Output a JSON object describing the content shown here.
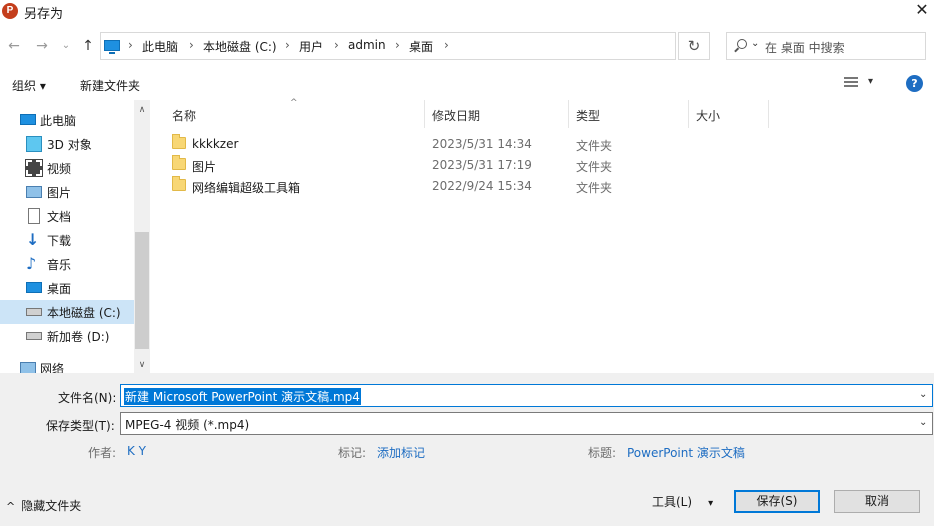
{
  "window": {
    "title": "另存为",
    "app_badge": "P",
    "close_glyph": "✕"
  },
  "nav_buttons": {
    "back": "←",
    "forward": "→",
    "recent": "⌄",
    "up": "↑"
  },
  "address": {
    "crumbs": [
      "此电脑",
      "本地磁盘 (C:)",
      "用户",
      "admin",
      "桌面"
    ],
    "separator": "›",
    "dropdown_glyph": "⌄",
    "refresh_glyph": "↻"
  },
  "search": {
    "placeholder": "在 桌面 中搜索"
  },
  "toolbar": {
    "organize": "组织 ▾",
    "new_folder": "新建文件夹",
    "view_dropdown": "▾",
    "help": "?"
  },
  "nav_pane": {
    "items": [
      {
        "label": "此电脑",
        "icon": "computer-icon",
        "selected": false
      },
      {
        "label": "3D 对象",
        "icon": "cube-icon",
        "selected": false
      },
      {
        "label": "视频",
        "icon": "video-icon",
        "selected": false
      },
      {
        "label": "图片",
        "icon": "picture-icon",
        "selected": false
      },
      {
        "label": "文档",
        "icon": "document-icon",
        "selected": false
      },
      {
        "label": "下载",
        "icon": "download-icon",
        "selected": false
      },
      {
        "label": "音乐",
        "icon": "music-icon",
        "selected": false
      },
      {
        "label": "桌面",
        "icon": "desktop-icon",
        "selected": false
      },
      {
        "label": "本地磁盘 (C:)",
        "icon": "drive-icon",
        "selected": true
      },
      {
        "label": "新加卷 (D:)",
        "icon": "drive-icon",
        "selected": false
      },
      {
        "label": "网络",
        "icon": "network-icon",
        "selected": false
      }
    ],
    "scroll_up": "∧",
    "scroll_down": "∨"
  },
  "file_list": {
    "columns": [
      "名称",
      "修改日期",
      "类型",
      "大小"
    ],
    "sort_indicator": "^",
    "rows": [
      {
        "name": "kkkkzer",
        "modified": "2023/5/31 14:34",
        "type": "文件夹",
        "size": ""
      },
      {
        "name": "图片",
        "modified": "2023/5/31 17:19",
        "type": "文件夹",
        "size": ""
      },
      {
        "name": "网络编辑超级工具箱",
        "modified": "2022/9/24 15:34",
        "type": "文件夹",
        "size": ""
      }
    ]
  },
  "form": {
    "filename_label": "文件名(N):",
    "filename_value": "新建 Microsoft PowerPoint 演示文稿.mp4",
    "filetype_label": "保存类型(T):",
    "filetype_value": "MPEG-4 视频 (*.mp4)",
    "dropdown_glyph": "⌄",
    "author_label": "作者:",
    "author_value": "K Y",
    "tags_label": "标记:",
    "tags_value": "添加标记",
    "title_label": "标题:",
    "title_value": "PowerPoint 演示文稿"
  },
  "footer": {
    "hide_folders": "隐藏文件夹",
    "hide_folders_glyph": "^",
    "tools": "工具(L)",
    "tools_glyph": "▾",
    "save": "保存(S)",
    "cancel": "取消"
  },
  "colors": {
    "accent": "#0078d7",
    "selection": "#cce4f7",
    "link": "#1e6dc2",
    "folder": "#f8d775",
    "panel": "#f0f0f0"
  }
}
